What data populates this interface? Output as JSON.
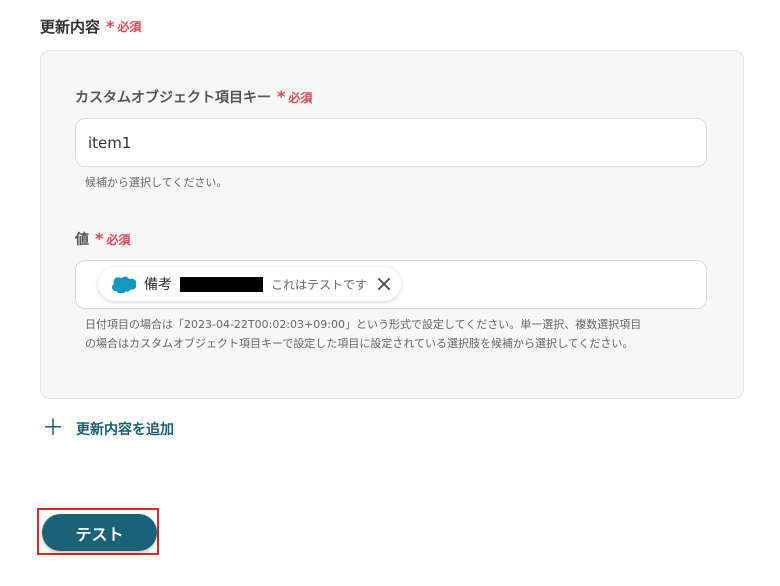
{
  "update_section": {
    "label": "更新内容",
    "required": "必須",
    "required_mark": "*"
  },
  "key_field": {
    "label": "カスタムオブジェクト項目キー",
    "required": "必須",
    "required_mark": "*",
    "value": "item1",
    "hint": "候補から選択してください。"
  },
  "value_field": {
    "label": "値",
    "required": "必須",
    "required_mark": "*",
    "chip": {
      "name": "備考",
      "value": "これはテストです",
      "icon": "salesforce-cloud-icon",
      "icon_color": "#1798c1"
    },
    "hint_line1": "日付項目の場合は「2023-04-22T00:02:03+09:00」という形式で設定してください。単一選択、複数選択項目",
    "hint_line2": "の場合はカスタムオブジェクト項目キーで設定した項目に設定されている選択肢を候補から選択してください。"
  },
  "add_update": {
    "label": "更新内容を追加",
    "icon": "plus-icon"
  },
  "test_button": {
    "label": "テスト"
  },
  "colors": {
    "accent": "#1b6277",
    "required": "#e0474f",
    "highlight": "#d42b2b"
  }
}
